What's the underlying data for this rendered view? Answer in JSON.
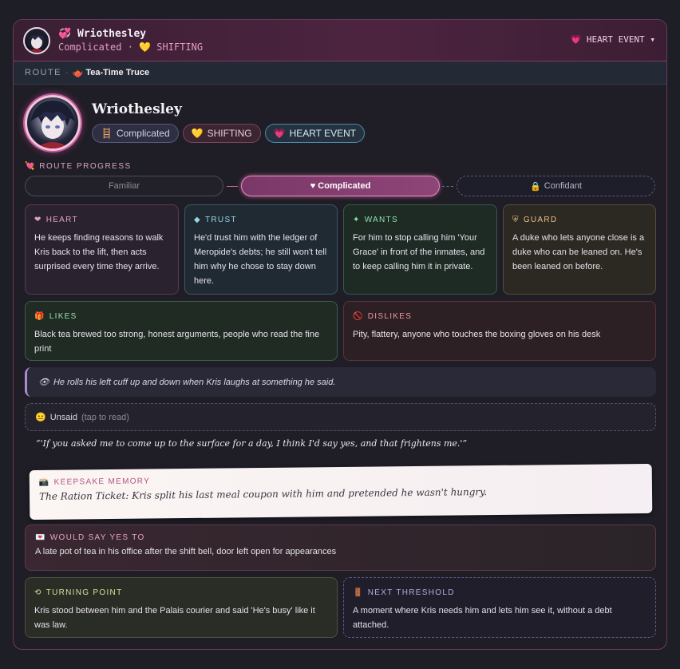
{
  "header": {
    "name": "Wriothesley",
    "name_icon": "hearts-icon",
    "status_text": "Complicated · 💛 SHIFTING",
    "event_label": "HEART EVENT ▾"
  },
  "route": {
    "label": "ROUTE",
    "separator": "·",
    "value": "Tea-Time Truce"
  },
  "profile": {
    "name": "Wriothesley",
    "chips": [
      "Complicated",
      "SHIFTING",
      "HEART EVENT"
    ]
  },
  "progress": {
    "label": "ROUTE PROGRESS",
    "steps": [
      "Familiar",
      "♥ Complicated",
      "Confidant"
    ],
    "current_step": 2
  },
  "traits": {
    "heart": {
      "title": "HEART",
      "text": "He keeps finding reasons to walk Kris back to the lift, then acts surprised every time they arrive."
    },
    "trust": {
      "title": "TRUST",
      "text": "He'd trust him with the ledger of Meropide's debts; he still won't tell him why he chose to stay down here."
    },
    "wants": {
      "title": "WANTS",
      "text": "For him to stop calling him 'Your Grace' in front of the inmates, and to keep calling him it in private."
    },
    "guard": {
      "title": "GUARD",
      "text": "A duke who lets anyone close is a duke who can be leaned on. He's been leaned on before."
    },
    "likes": {
      "title": "LIKES",
      "text": "Black tea brewed too strong, honest arguments, people who read the fine print"
    },
    "dislikes": {
      "title": "DISLIKES",
      "text": "Pity, flattery, anyone who touches the boxing gloves on his desk"
    }
  },
  "gesture": "He rolls his left cuff up and down when Kris laughs at something he said.",
  "unsaid": {
    "label": "Unsaid",
    "hint": "(tap to read)"
  },
  "quote": "“'If you asked me to come up to the surface for a day, I think I'd say yes, and that frightens me.'”",
  "keepsake": {
    "title": "KEEPSAKE MEMORY",
    "text": "The Ration Ticket: Kris split his last meal coupon with him and pretended he wasn't hungry."
  },
  "would_say_yes": {
    "title": "WOULD SAY YES TO",
    "text": "A late pot of tea in his office after the shift bell, door left open for appearances"
  },
  "turning_point": {
    "title": "TURNING POINT",
    "text": "Kris stood between him and the Palais courier and said 'He's busy' like it was law."
  },
  "next_threshold": {
    "title": "NEXT THRESHOLD",
    "text": "A moment where Kris needs him and lets him see it, without a debt attached."
  }
}
